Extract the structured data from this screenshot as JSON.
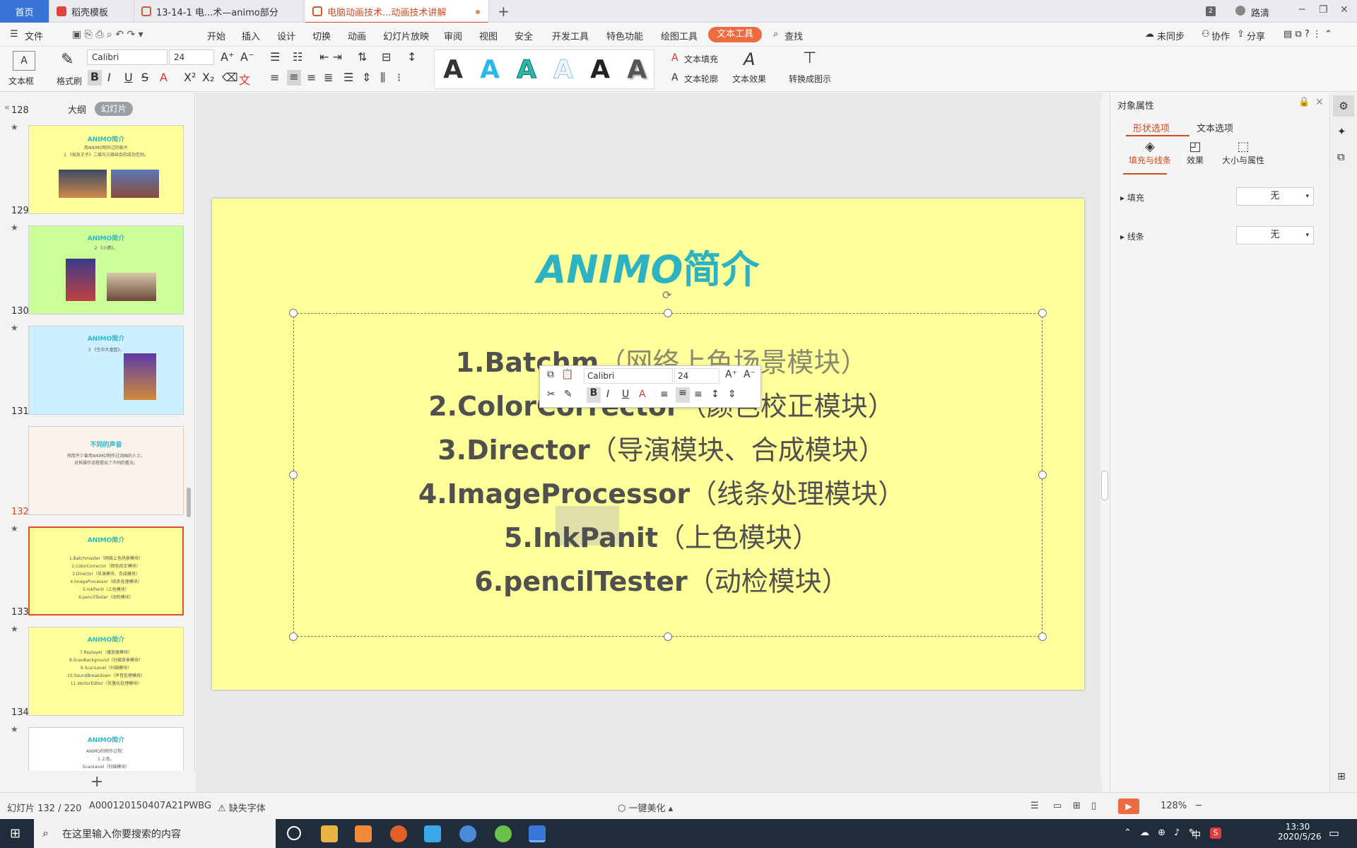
{
  "tabs": {
    "home": "首页",
    "t2": "稻壳模板",
    "t3": "13-14-1 电...术—animo部分",
    "t4": "电脑动画技术...动画技术讲解"
  },
  "topright": {
    "count": "2",
    "user": "路清"
  },
  "menu": [
    "文件",
    "开始",
    "插入",
    "设计",
    "切换",
    "动画",
    "幻灯片放映",
    "审阅",
    "视图",
    "安全",
    "开发工具",
    "特色功能",
    "绘图工具",
    "文本工具",
    "查找"
  ],
  "menu_right": {
    "sync": "未同步",
    "collab": "协作",
    "share": "分享"
  },
  "ribbon": {
    "textbox": "文本框",
    "format_painter": "格式刷",
    "font": "Calibri",
    "size": "24",
    "text_fill": "文本填充",
    "text_outline": "文本轮廓",
    "text_effect": "文本效果",
    "convert": "转换成图示"
  },
  "left_panel": {
    "outline": "大纲",
    "slides": "幻灯片"
  },
  "thumbnails": [
    {
      "num": "128",
      "title": "ANIMO简介",
      "lines": [
        "用ANIMO制作过的影片",
        "1 《埃及王子》二维与三维结合的成功范例。"
      ],
      "bg": "#ffff99"
    },
    {
      "num": "129",
      "title": "ANIMO简介",
      "lines": [
        "2 《小倩》。"
      ],
      "bg": "#ccff99"
    },
    {
      "num": "130",
      "title": "ANIMO简介",
      "lines": [
        "3 《空中大灌篮》。"
      ],
      "bg": "#ccf0ff"
    },
    {
      "num": "131",
      "title": "不同的声音",
      "lines": [
        "然而不少曾用ANIMO制作过动画的人士，",
        "对其操作流程提出了不同的看法。"
      ],
      "bg": "#fbf3ec"
    },
    {
      "num": "132",
      "title": "ANIMO简介",
      "lines": [
        "1.Batchmaster（网络上色场景模块）",
        "2.ColorCorrector（颜色校正模块）",
        "3.Director（导演模块、合成模块）",
        "4.ImageProcessor（线条处理模块）",
        "5.InkPanit（上色模块）",
        "6.pencilTester（动检模块）"
      ],
      "bg": "#ffff99"
    },
    {
      "num": "133",
      "title": "ANIMO简介",
      "lines": [
        "7.Replayer（播放器模块）",
        "8.ScanBackground（扫描背景模块）",
        "9.ScanLevel（扫描模块）",
        "10.SoundBreakdown（声音处理模块）",
        "11.VectorEditor（矢量化处理模块）"
      ],
      "bg": "#ffff99"
    },
    {
      "num": "134",
      "title": "ANIMO简介",
      "lines": [
        "ANIMO的制作过程：",
        "1.上色。",
        "ScanLevel（扫描模块）"
      ],
      "bg": "#ffffff"
    }
  ],
  "slide": {
    "title_latin": "ANIMO",
    "title_cn": "简介",
    "items": [
      {
        "latin": "1.Batchm",
        "cn": "（网络上色场景模块）"
      },
      {
        "latin": "2.ColorCorrector",
        "cn": "（颜色校正模块）"
      },
      {
        "latin": "3.Director",
        "cn": "（导演模块、合成模块）"
      },
      {
        "latin": "4.ImageProcessor",
        "cn": "（线条处理模块）"
      },
      {
        "latin": "5.InkPanit",
        "cn": "（上色模块）"
      },
      {
        "latin": "6.pencilTester",
        "cn": "（动检模块）"
      }
    ]
  },
  "floatbar": {
    "font": "Calibri",
    "size": "24"
  },
  "right_panel": {
    "title": "对象属性",
    "tab_shape": "形状选项",
    "tab_text": "文本选项",
    "fill_line": "填充与线条",
    "effect": "效果",
    "size_prop": "大小与属性",
    "fill": "填充",
    "fill_value": "无",
    "line": "线条",
    "line_value": "无"
  },
  "status": {
    "slide": "幻灯片 132 / 220",
    "id": "A000120150407A21PWBG",
    "missing_font": "缺失字体",
    "beautify": "一键美化",
    "zoom": "128%"
  },
  "taskbar": {
    "search": "在这里输入你要搜索的内容",
    "time": "13:30",
    "date": "2020/5/26",
    "ime": "中"
  },
  "colors": {
    "accent": "#ee6b3f",
    "slide_bg": "#ffff99",
    "title": "#2bb3c3",
    "taskbar": "#1f2d3a"
  }
}
